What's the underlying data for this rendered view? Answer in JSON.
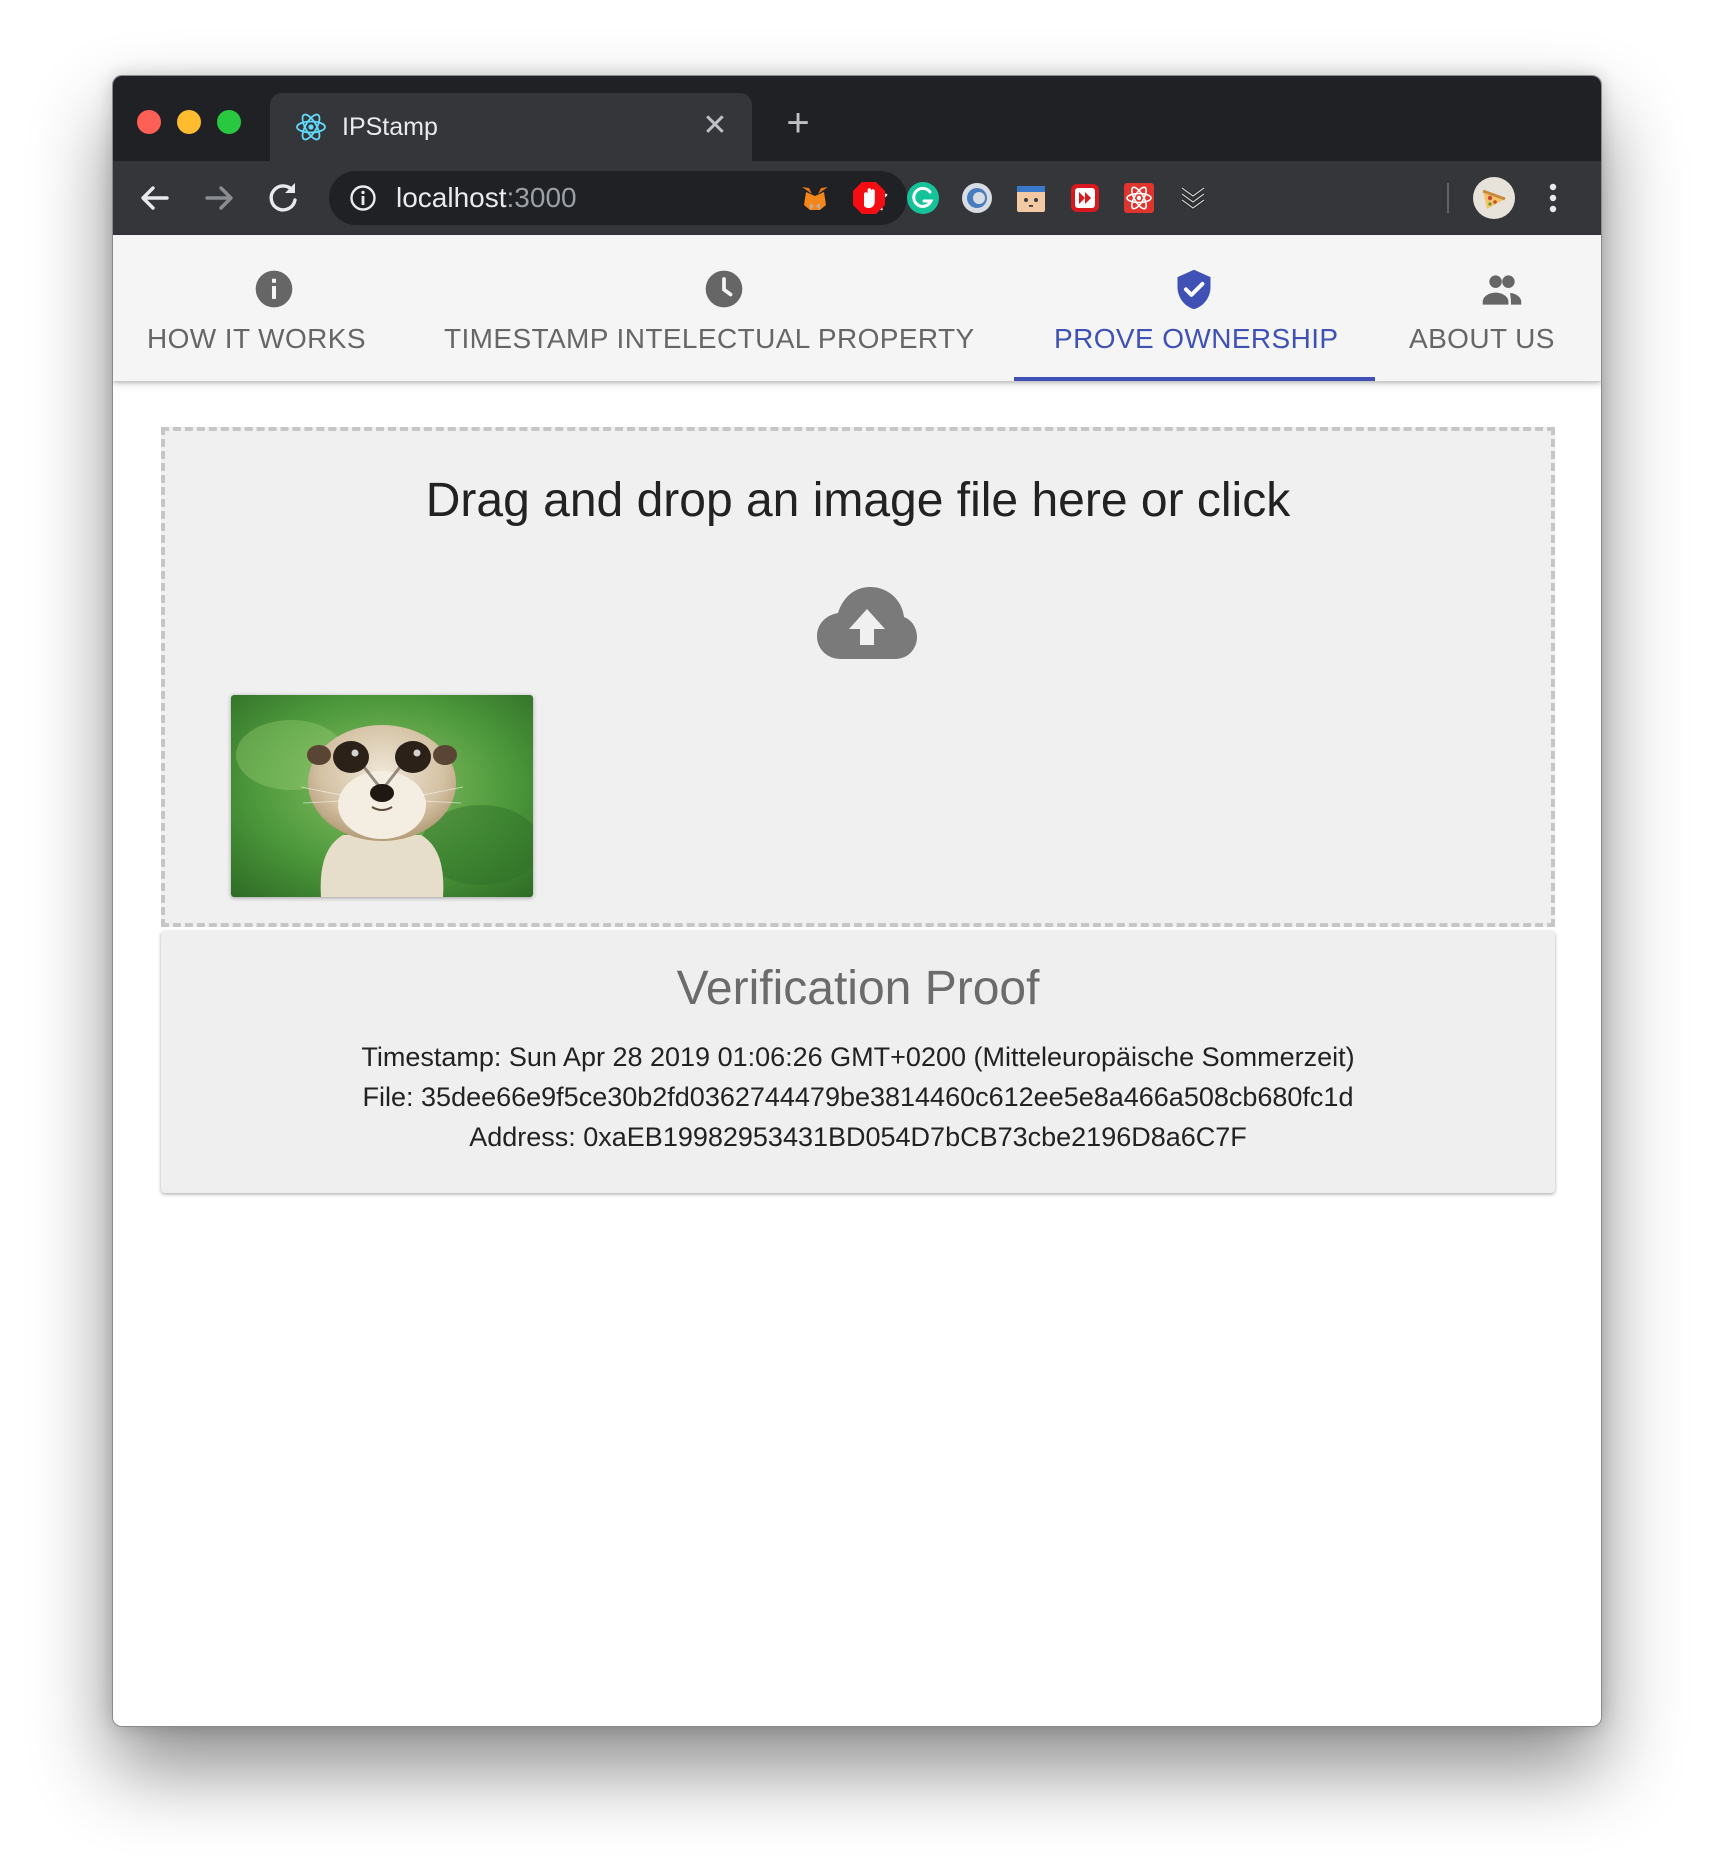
{
  "browser": {
    "tab_title": "IPStamp",
    "tab_close_glyph": "✕",
    "new_tab_glyph": "+",
    "url_host": "localhost",
    "url_port": ":3000",
    "extension_icons": [
      "metamask-icon",
      "adblock-icon",
      "grammarly-icon",
      "extension-blue-icon",
      "extension-box-icon",
      "extension-red-play-icon",
      "extension-react-icon",
      "extension-chevrons-icon"
    ]
  },
  "app": {
    "tabs": [
      {
        "label": "HOW IT WORKS",
        "icon": "info-icon"
      },
      {
        "label": "TIMESTAMP INTELECTUAL PROPERTY",
        "icon": "clock-icon"
      },
      {
        "label": "PROVE OWNERSHIP",
        "icon": "verified-shield-icon",
        "active": true
      },
      {
        "label": "ABOUT US",
        "icon": "people-icon"
      }
    ],
    "dropzone": {
      "text": "Drag and drop an image file here or click",
      "icon": "cloud-upload-icon",
      "thumbnail": "meerkat-photo"
    },
    "proof": {
      "title": "Verification Proof",
      "timestamp": "Timestamp: Sun Apr 28 2019 01:06:26 GMT+0200 (Mitteleuropäische Sommerzeit)",
      "file": "File: 35dee66e9f5ce30b2fd0362744479be3814460c612ee5e8a466a508cb680fc1d",
      "address": "Address: 0xaEB19982953431BD054D7bCB73cbe2196D8a6C7F"
    }
  },
  "colors": {
    "accent": "#3f51b5",
    "tab_inactive": "#666666",
    "chrome_dark": "#202124",
    "chrome_toolbar": "#35363a"
  }
}
